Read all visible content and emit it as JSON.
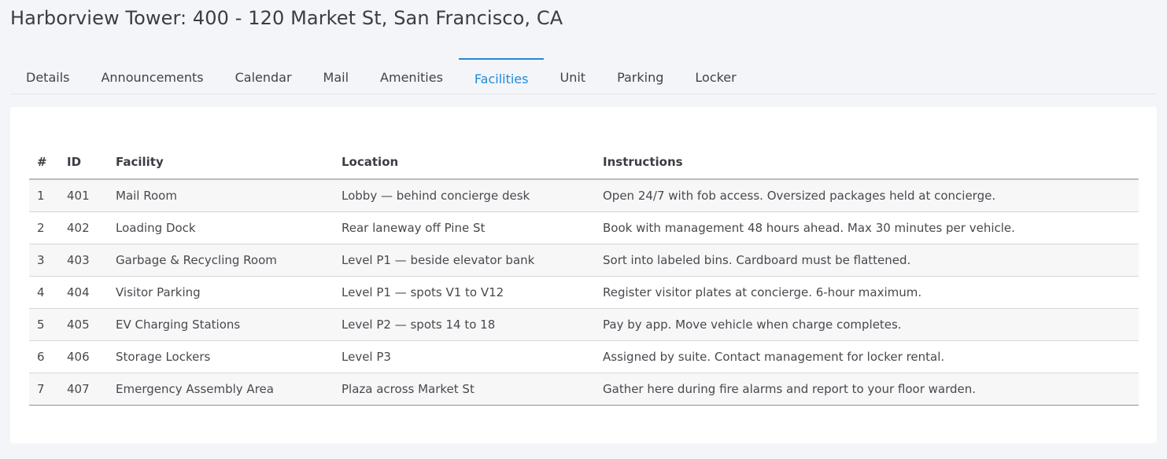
{
  "page": {
    "title": "Harborview Tower: 400 - 120 Market St, San Francisco, CA"
  },
  "tabs": [
    {
      "label": "Details",
      "active": false
    },
    {
      "label": "Announcements",
      "active": false
    },
    {
      "label": "Calendar",
      "active": false
    },
    {
      "label": "Mail",
      "active": false
    },
    {
      "label": "Amenities",
      "active": false
    },
    {
      "label": "Facilities",
      "active": true
    },
    {
      "label": "Unit",
      "active": false
    },
    {
      "label": "Parking",
      "active": false
    },
    {
      "label": "Locker",
      "active": false
    }
  ],
  "colors": {
    "accent": "#1f8ad8",
    "background": "#f4f5f8",
    "card": "#ffffff"
  },
  "table": {
    "headers": [
      "#",
      "ID",
      "Facility",
      "Location",
      "Instructions"
    ],
    "rows": [
      [
        "1",
        "401",
        "Mail Room",
        "Lobby — behind concierge desk",
        "Open 24/7 with fob access. Oversized packages held at concierge."
      ],
      [
        "2",
        "402",
        "Loading Dock",
        "Rear laneway off Pine St",
        "Book with management 48 hours ahead. Max 30 minutes per vehicle."
      ],
      [
        "3",
        "403",
        "Garbage & Recycling Room",
        "Level P1 — beside elevator bank",
        "Sort into labeled bins. Cardboard must be flattened."
      ],
      [
        "4",
        "404",
        "Visitor Parking",
        "Level P1 — spots V1 to V12",
        "Register visitor plates at concierge. 6-hour maximum."
      ],
      [
        "5",
        "405",
        "EV Charging Stations",
        "Level P2 — spots 14 to 18",
        "Pay by app. Move vehicle when charge completes."
      ],
      [
        "6",
        "406",
        "Storage Lockers",
        "Level P3",
        "Assigned by suite. Contact management for locker rental."
      ],
      [
        "7",
        "407",
        "Emergency Assembly Area",
        "Plaza across Market St",
        "Gather here during fire alarms and report to your floor warden."
      ]
    ]
  }
}
